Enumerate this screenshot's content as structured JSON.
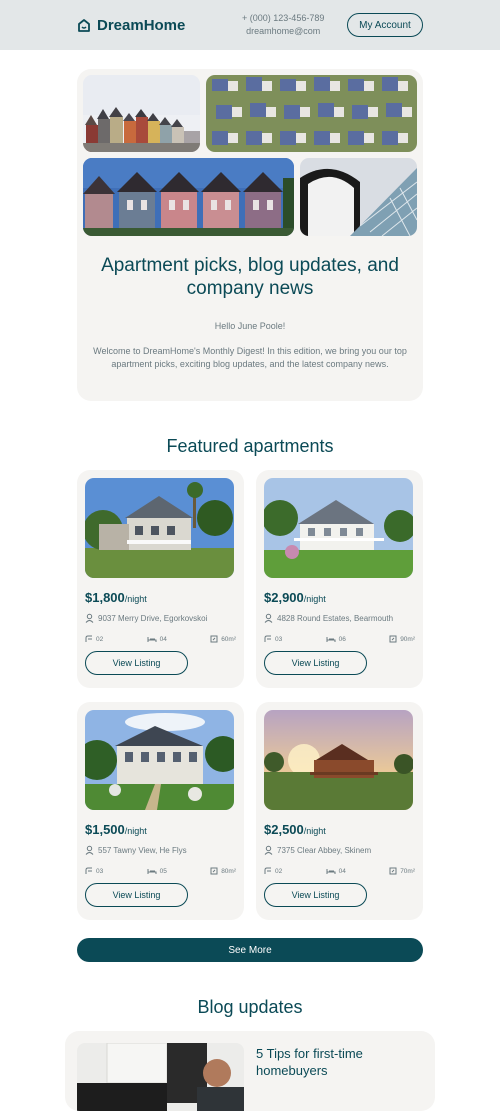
{
  "header": {
    "brand": "DreamHome",
    "phone": "+ (000) 123-456-789",
    "email": "dreamhome@com",
    "account_button": "My Account"
  },
  "hero": {
    "title": "Apartment picks, blog updates, and company news",
    "greeting": "Hello June Poole!",
    "intro": "Welcome to DreamHome's Monthly Digest! In this edition, we bring you our top apartment picks, exciting blog updates, and the latest company news."
  },
  "featured": {
    "title": "Featured apartments",
    "view_label": "View Listing",
    "listings": [
      {
        "price": "$1,800",
        "unit": "/night",
        "address": "9037 Merry Drive, Egorkovskoi",
        "baths": "02",
        "beds": "04",
        "area": "60m²"
      },
      {
        "price": "$2,900",
        "unit": "/night",
        "address": "4828 Round Estates, Bearmouth",
        "baths": "03",
        "beds": "06",
        "area": "90m²"
      },
      {
        "price": "$1,500",
        "unit": "/night",
        "address": "557 Tawny View, He Flys",
        "baths": "03",
        "beds": "05",
        "area": "80m²"
      },
      {
        "price": "$2,500",
        "unit": "/night",
        "address": "7375 Clear Abbey, Skinem",
        "baths": "02",
        "beds": "04",
        "area": "70m²"
      }
    ],
    "see_more": "See More"
  },
  "blog": {
    "title": "Blog updates",
    "post_title": "5 Tips for first-time homebuyers"
  },
  "colors": {
    "primary": "#0b4a56",
    "card_bg": "#f5f4f2",
    "header_bg": "#e3e7e8",
    "muted_text": "#6b7a80"
  }
}
